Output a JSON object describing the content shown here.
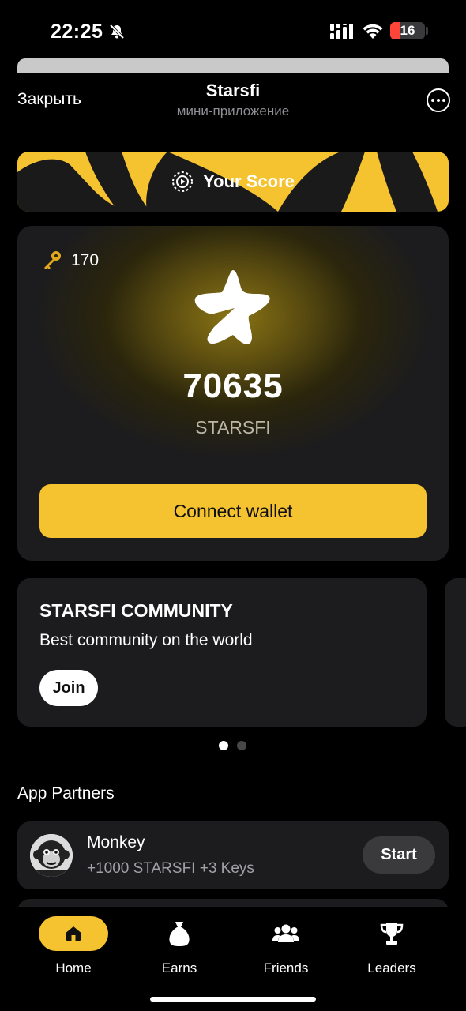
{
  "status_bar": {
    "time": "22:25",
    "battery": "16"
  },
  "header": {
    "close_label": "Закрыть",
    "title": "Starsfi",
    "subtitle": "мини-приложение"
  },
  "banner": {
    "label": "Your Score"
  },
  "score_card": {
    "keys": "170",
    "score": "70635",
    "unit": "STARSFI",
    "connect_label": "Connect wallet"
  },
  "community": {
    "title": "STARSFI COMMUNITY",
    "description": "Best community on the world",
    "join_label": "Join"
  },
  "carousel": {
    "active_index": 0,
    "count": 2
  },
  "partners": {
    "title": "App Partners",
    "items": [
      {
        "name": "Monkey",
        "reward": "+1000 STARSFI +3 Keys",
        "action": "Start"
      }
    ]
  },
  "tabs": [
    {
      "label": "Home",
      "icon": "home-icon",
      "active": true
    },
    {
      "label": "Earns",
      "icon": "money-bag-icon",
      "active": false
    },
    {
      "label": "Friends",
      "icon": "friends-icon",
      "active": false
    },
    {
      "label": "Leaders",
      "icon": "trophy-icon",
      "active": false
    }
  ],
  "colors": {
    "accent": "#f5c230",
    "background": "#000000",
    "card": "#1c1c1e",
    "battery_low": "#ff453a"
  }
}
